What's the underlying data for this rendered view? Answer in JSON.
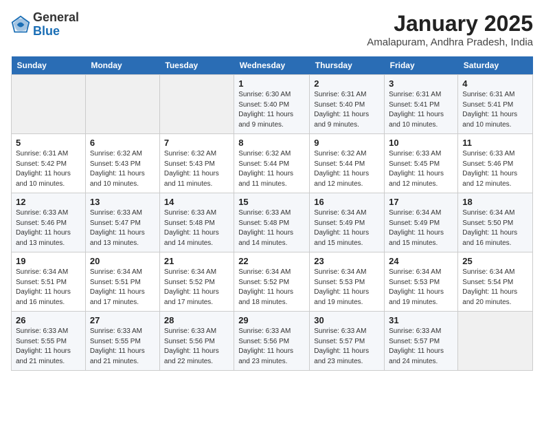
{
  "logo": {
    "general": "General",
    "blue": "Blue"
  },
  "header": {
    "title": "January 2025",
    "subtitle": "Amalapuram, Andhra Pradesh, India"
  },
  "weekdays": [
    "Sunday",
    "Monday",
    "Tuesday",
    "Wednesday",
    "Thursday",
    "Friday",
    "Saturday"
  ],
  "weeks": [
    [
      {
        "day": "",
        "info": ""
      },
      {
        "day": "",
        "info": ""
      },
      {
        "day": "",
        "info": ""
      },
      {
        "day": "1",
        "info": "Sunrise: 6:30 AM\nSunset: 5:40 PM\nDaylight: 11 hours\nand 9 minutes."
      },
      {
        "day": "2",
        "info": "Sunrise: 6:31 AM\nSunset: 5:40 PM\nDaylight: 11 hours\nand 9 minutes."
      },
      {
        "day": "3",
        "info": "Sunrise: 6:31 AM\nSunset: 5:41 PM\nDaylight: 11 hours\nand 10 minutes."
      },
      {
        "day": "4",
        "info": "Sunrise: 6:31 AM\nSunset: 5:41 PM\nDaylight: 11 hours\nand 10 minutes."
      }
    ],
    [
      {
        "day": "5",
        "info": "Sunrise: 6:31 AM\nSunset: 5:42 PM\nDaylight: 11 hours\nand 10 minutes."
      },
      {
        "day": "6",
        "info": "Sunrise: 6:32 AM\nSunset: 5:43 PM\nDaylight: 11 hours\nand 10 minutes."
      },
      {
        "day": "7",
        "info": "Sunrise: 6:32 AM\nSunset: 5:43 PM\nDaylight: 11 hours\nand 11 minutes."
      },
      {
        "day": "8",
        "info": "Sunrise: 6:32 AM\nSunset: 5:44 PM\nDaylight: 11 hours\nand 11 minutes."
      },
      {
        "day": "9",
        "info": "Sunrise: 6:32 AM\nSunset: 5:44 PM\nDaylight: 11 hours\nand 12 minutes."
      },
      {
        "day": "10",
        "info": "Sunrise: 6:33 AM\nSunset: 5:45 PM\nDaylight: 11 hours\nand 12 minutes."
      },
      {
        "day": "11",
        "info": "Sunrise: 6:33 AM\nSunset: 5:46 PM\nDaylight: 11 hours\nand 12 minutes."
      }
    ],
    [
      {
        "day": "12",
        "info": "Sunrise: 6:33 AM\nSunset: 5:46 PM\nDaylight: 11 hours\nand 13 minutes."
      },
      {
        "day": "13",
        "info": "Sunrise: 6:33 AM\nSunset: 5:47 PM\nDaylight: 11 hours\nand 13 minutes."
      },
      {
        "day": "14",
        "info": "Sunrise: 6:33 AM\nSunset: 5:48 PM\nDaylight: 11 hours\nand 14 minutes."
      },
      {
        "day": "15",
        "info": "Sunrise: 6:33 AM\nSunset: 5:48 PM\nDaylight: 11 hours\nand 14 minutes."
      },
      {
        "day": "16",
        "info": "Sunrise: 6:34 AM\nSunset: 5:49 PM\nDaylight: 11 hours\nand 15 minutes."
      },
      {
        "day": "17",
        "info": "Sunrise: 6:34 AM\nSunset: 5:49 PM\nDaylight: 11 hours\nand 15 minutes."
      },
      {
        "day": "18",
        "info": "Sunrise: 6:34 AM\nSunset: 5:50 PM\nDaylight: 11 hours\nand 16 minutes."
      }
    ],
    [
      {
        "day": "19",
        "info": "Sunrise: 6:34 AM\nSunset: 5:51 PM\nDaylight: 11 hours\nand 16 minutes."
      },
      {
        "day": "20",
        "info": "Sunrise: 6:34 AM\nSunset: 5:51 PM\nDaylight: 11 hours\nand 17 minutes."
      },
      {
        "day": "21",
        "info": "Sunrise: 6:34 AM\nSunset: 5:52 PM\nDaylight: 11 hours\nand 17 minutes."
      },
      {
        "day": "22",
        "info": "Sunrise: 6:34 AM\nSunset: 5:52 PM\nDaylight: 11 hours\nand 18 minutes."
      },
      {
        "day": "23",
        "info": "Sunrise: 6:34 AM\nSunset: 5:53 PM\nDaylight: 11 hours\nand 19 minutes."
      },
      {
        "day": "24",
        "info": "Sunrise: 6:34 AM\nSunset: 5:53 PM\nDaylight: 11 hours\nand 19 minutes."
      },
      {
        "day": "25",
        "info": "Sunrise: 6:34 AM\nSunset: 5:54 PM\nDaylight: 11 hours\nand 20 minutes."
      }
    ],
    [
      {
        "day": "26",
        "info": "Sunrise: 6:33 AM\nSunset: 5:55 PM\nDaylight: 11 hours\nand 21 minutes."
      },
      {
        "day": "27",
        "info": "Sunrise: 6:33 AM\nSunset: 5:55 PM\nDaylight: 11 hours\nand 21 minutes."
      },
      {
        "day": "28",
        "info": "Sunrise: 6:33 AM\nSunset: 5:56 PM\nDaylight: 11 hours\nand 22 minutes."
      },
      {
        "day": "29",
        "info": "Sunrise: 6:33 AM\nSunset: 5:56 PM\nDaylight: 11 hours\nand 23 minutes."
      },
      {
        "day": "30",
        "info": "Sunrise: 6:33 AM\nSunset: 5:57 PM\nDaylight: 11 hours\nand 23 minutes."
      },
      {
        "day": "31",
        "info": "Sunrise: 6:33 AM\nSunset: 5:57 PM\nDaylight: 11 hours\nand 24 minutes."
      },
      {
        "day": "",
        "info": ""
      }
    ]
  ]
}
